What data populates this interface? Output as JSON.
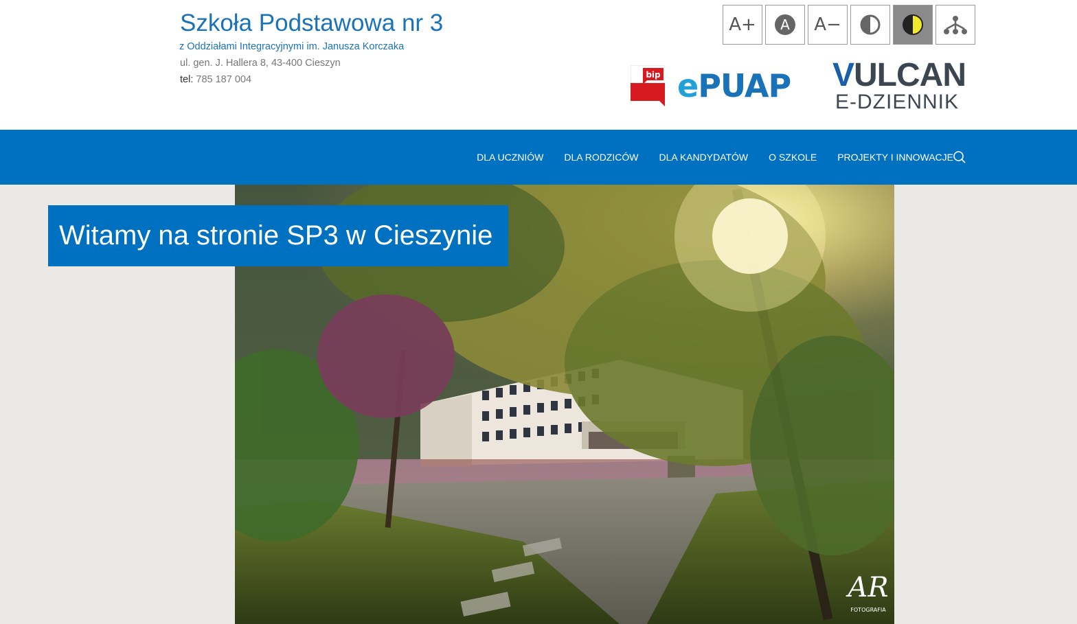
{
  "header": {
    "school_name": "Szkoła Podstawowa nr 3",
    "school_sub": "z Oddziałami Integracyjnymi im. Janusza Korczaka",
    "address": "ul. gen. J. Hallera 8, 43-400 Cieszyn",
    "tel_label": "tel:",
    "tel_value": "785 187 004"
  },
  "accessibility": {
    "font_increase": "A+",
    "font_default": "A",
    "font_decrease": "A−"
  },
  "logos": {
    "bip": "bip",
    "epuap_e": "e",
    "epuap_rest": "PUAP",
    "vulcan_v": "V",
    "vulcan_rest": "ULCAN",
    "edziennik": "E-DZIENNIK"
  },
  "nav": {
    "items": [
      "DLA UCZNIÓW",
      "DLA RODZICÓW",
      "DLA KANDYDATÓW",
      "O SZKOLE",
      "PROJEKTY I INNOWACJE"
    ]
  },
  "hero": {
    "title": "Witamy na stronie SP3 w Cieszynie",
    "watermark": "AR",
    "watermark_sub": "FOTOGRAFIA"
  },
  "colors": {
    "brand_blue": "#0070c0",
    "link_blue": "#1a73b8",
    "contrast_yellow": "#f2ea2c"
  }
}
